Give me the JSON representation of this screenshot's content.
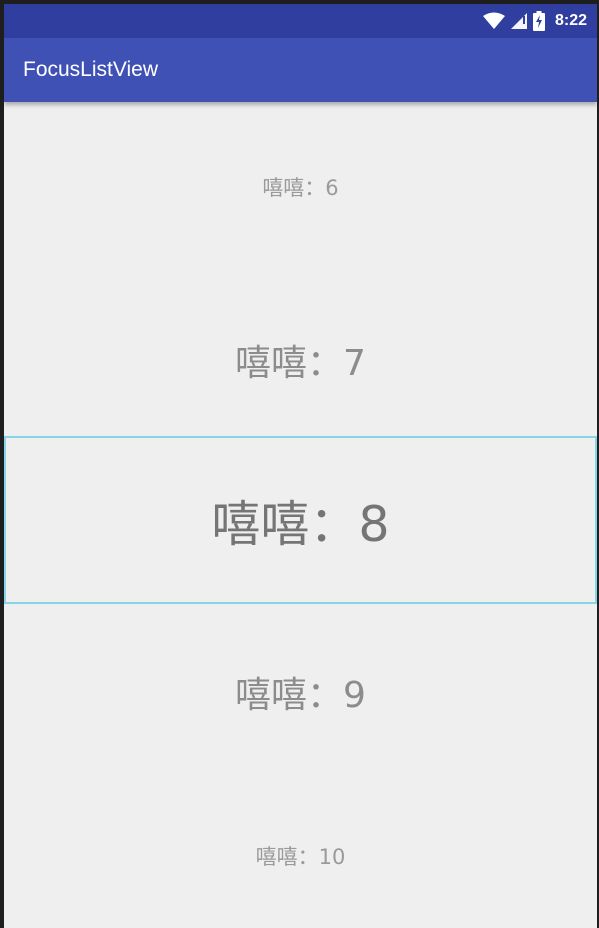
{
  "status_bar": {
    "time": "8:22",
    "icons": [
      "wifi-icon",
      "cell-signal-icon",
      "battery-charging-icon"
    ],
    "color": "#303f9f"
  },
  "app_bar": {
    "title": "FocusListView",
    "color": "#3f51b5"
  },
  "list": {
    "focus_border_color": "#86d3ea",
    "items": [
      {
        "label": "嘻嘻：6"
      },
      {
        "label": "嘻嘻：7"
      },
      {
        "label": "嘻嘻：8",
        "focused": true
      },
      {
        "label": "嘻嘻：9"
      },
      {
        "label": "嘻嘻：10"
      }
    ]
  }
}
